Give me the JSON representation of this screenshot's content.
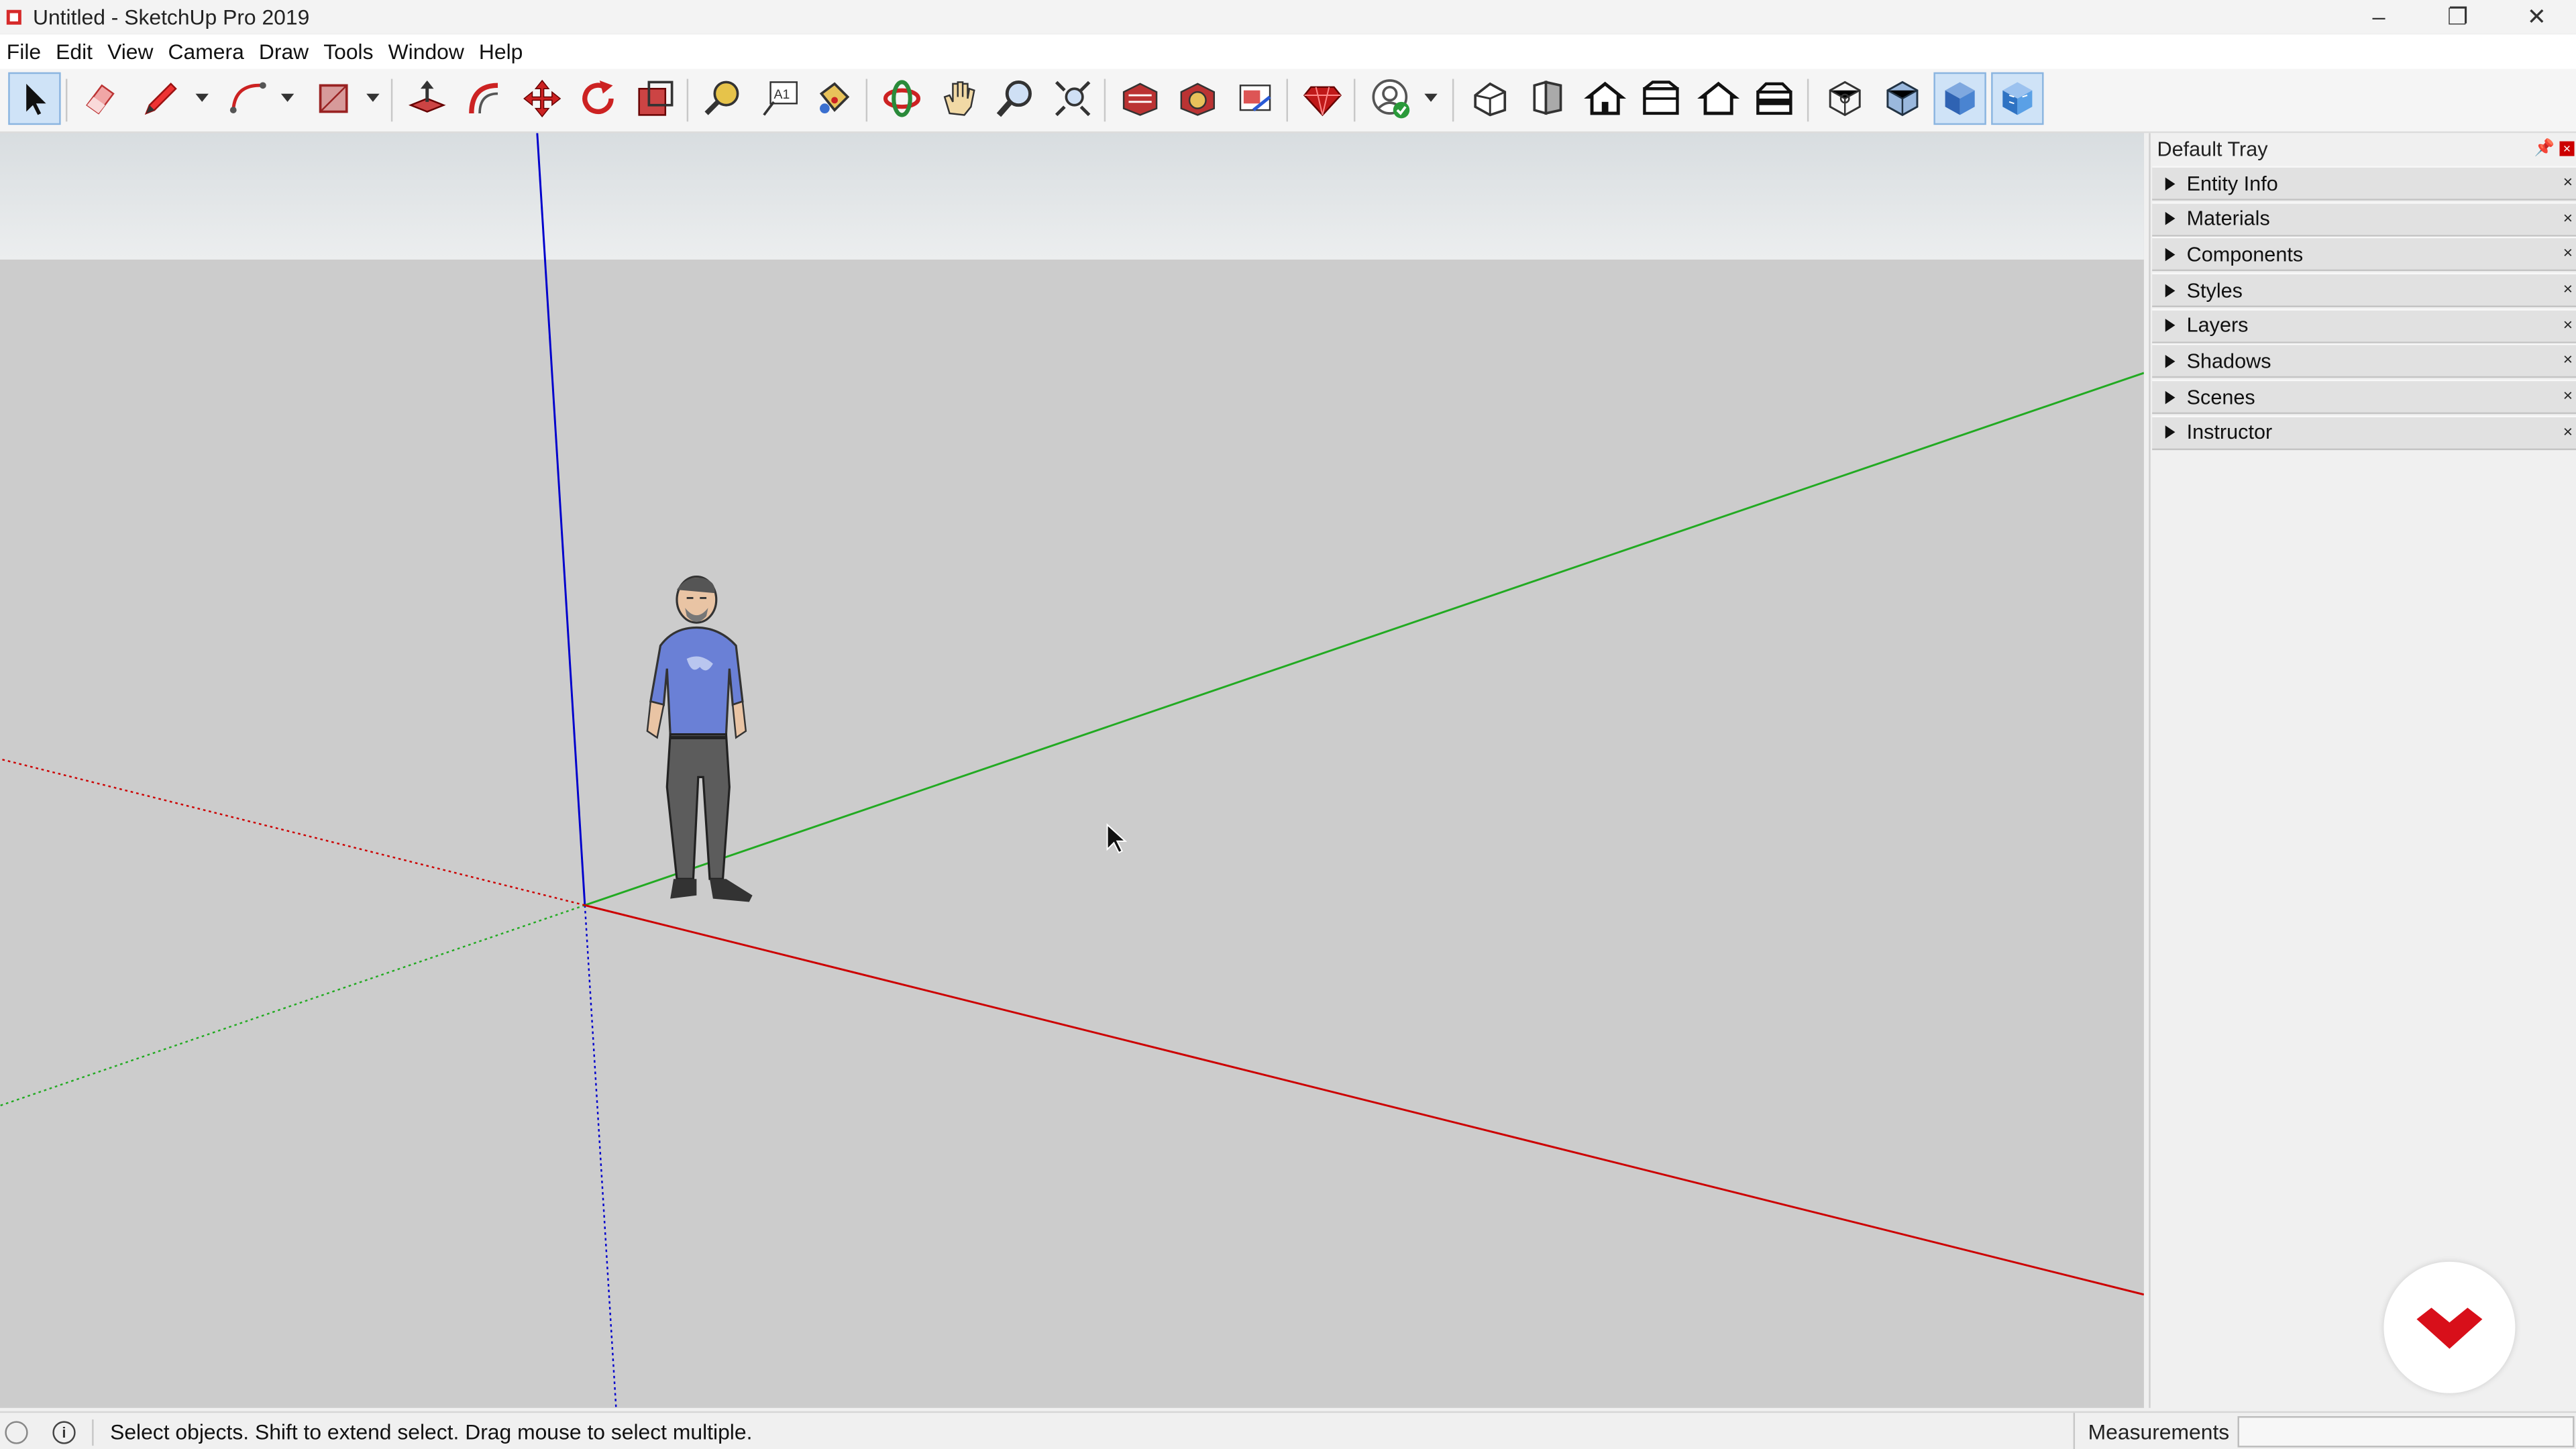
{
  "window": {
    "title": "Untitled - SketchUp Pro 2019",
    "controls": [
      "minimize",
      "restore",
      "close"
    ]
  },
  "menu": [
    "File",
    "Edit",
    "View",
    "Camera",
    "Draw",
    "Tools",
    "Window",
    "Help"
  ],
  "toolbar": {
    "tools": [
      {
        "name": "select-tool",
        "icon": "arrow-icon",
        "active": true
      },
      {
        "name": "eraser-tool",
        "icon": "eraser-icon"
      },
      {
        "name": "line-tool",
        "icon": "pencil-icon",
        "dropdown": true
      },
      {
        "name": "arc-tool",
        "icon": "arc-icon",
        "dropdown": true
      },
      {
        "name": "rectangle-tool",
        "icon": "rectangle-icon",
        "dropdown": true
      },
      {
        "name": "push-pull-tool",
        "icon": "push-pull-icon"
      },
      {
        "name": "offset-tool",
        "icon": "offset-icon"
      },
      {
        "name": "move-tool",
        "icon": "move-icon"
      },
      {
        "name": "rotate-tool",
        "icon": "rotate-icon"
      },
      {
        "name": "scale-tool",
        "icon": "scale-icon"
      },
      {
        "name": "tape-measure-tool",
        "icon": "tape-measure-icon"
      },
      {
        "name": "text-tool",
        "icon": "text-icon"
      },
      {
        "name": "paint-bucket-tool",
        "icon": "paint-bucket-icon"
      },
      {
        "name": "orbit-tool",
        "icon": "orbit-icon"
      },
      {
        "name": "pan-tool",
        "icon": "hand-icon"
      },
      {
        "name": "zoom-tool",
        "icon": "zoom-icon"
      },
      {
        "name": "zoom-extents-tool",
        "icon": "zoom-extents-icon"
      },
      {
        "name": "3d-warehouse-button",
        "icon": "warehouse-icon"
      },
      {
        "name": "extension-warehouse-button",
        "icon": "extension-warehouse-icon"
      },
      {
        "name": "layout-button",
        "icon": "layout-icon"
      },
      {
        "name": "extension-manager-button",
        "icon": "ruby-icon"
      },
      {
        "name": "account-button",
        "icon": "account-icon",
        "dropdown": true
      },
      {
        "name": "iso-view-button",
        "icon": "iso-house-icon"
      },
      {
        "name": "top-view-button",
        "icon": "top-view-icon"
      },
      {
        "name": "front-view-button",
        "icon": "front-house-icon"
      },
      {
        "name": "right-view-button",
        "icon": "right-house-icon"
      },
      {
        "name": "back-view-button",
        "icon": "back-house-icon"
      },
      {
        "name": "left-view-button",
        "icon": "left-house-icon"
      },
      {
        "name": "xray-style-button",
        "icon": "xray-icon"
      },
      {
        "name": "wireframe-style-button",
        "icon": "wireframe-icon"
      },
      {
        "name": "shaded-style-button",
        "icon": "shaded-icon",
        "active": true
      },
      {
        "name": "shaded-textures-style-button",
        "icon": "shaded-textures-icon",
        "active": true
      }
    ]
  },
  "tray": {
    "title": "Default Tray",
    "panels": [
      "Entity Info",
      "Materials",
      "Components",
      "Styles",
      "Layers",
      "Shadows",
      "Scenes",
      "Instructor"
    ]
  },
  "status": {
    "hint": "Select objects. Shift to extend select. Drag mouse to select multiple.",
    "measurements_label": "Measurements",
    "measurements_value": ""
  },
  "colors": {
    "blue_axis": "#0000cc",
    "green_axis": "#22aa22",
    "red_axis": "#cc0000",
    "ground": "#cccccc",
    "sky": "#e6e9ea",
    "active_tool": "#cfe3f7"
  }
}
